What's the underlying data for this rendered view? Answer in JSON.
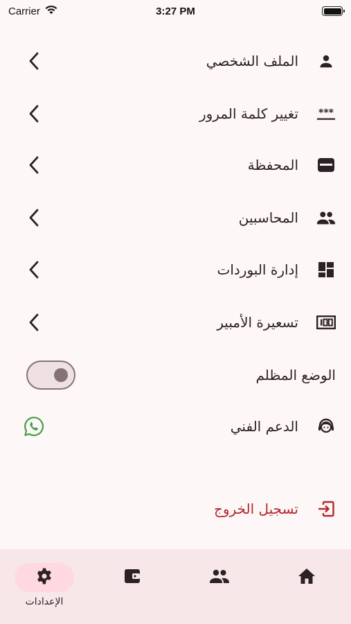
{
  "status": {
    "carrier": "Carrier",
    "time": "3:27 PM"
  },
  "menu": {
    "profile": "الملف الشخصي",
    "change_password": "تغيير كلمة المرور",
    "wallet": "المحفظة",
    "accountants": "المحاسبين",
    "boards": "إدارة البوردات",
    "ampere_pricing": "تسعيرة الأمبير",
    "dark_mode": "الوضع المظلم",
    "support": "الدعم الفني",
    "logout": "تسجيل الخروج"
  },
  "dark_mode_enabled": false,
  "nav": {
    "settings_label": "الإعدادات",
    "active": "settings"
  },
  "colors": {
    "background": "#fdf7f7",
    "logout": "#b3282f",
    "whatsapp": "#43a047",
    "nav_background": "#f7e7e9",
    "nav_active_pill": "#ffd9df"
  }
}
